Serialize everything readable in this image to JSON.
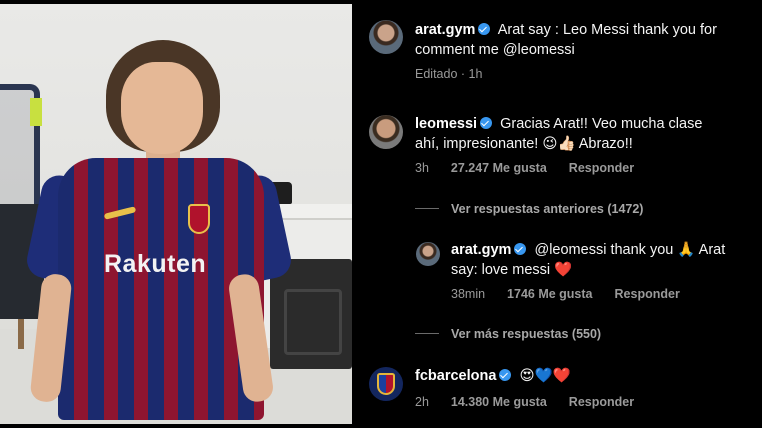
{
  "comments": [
    {
      "username": "arat.gym",
      "text": "Arat say : Leo Messi thank you for comment me @leomessi",
      "time": "Editado · 1h"
    },
    {
      "username": "leomessi",
      "text_line1": "Gracias Arat!! Veo mucha clase",
      "text_line2": "ahí, impresionante! ",
      "emojis": "😉👍🏻",
      "text_end": " Abrazo!!",
      "time": "3h",
      "likes": "27.247 Me gusta",
      "reply": "Responder",
      "view_previous": "Ver respuestas anteriores (1472)",
      "reply_thread": {
        "username": "arat.gym",
        "text_line1": "@leomessi thank you",
        "pray_emoji": "🙏",
        "text_line1_end": " Arat",
        "text_line2": "say: love messi",
        "heart_emoji": "❤️",
        "time": "38min",
        "likes": "1746 Me gusta",
        "reply": "Responder"
      },
      "view_more": "Ver más respuestas (550)"
    },
    {
      "username": "fcbarcelona",
      "emojis_face": "😍",
      "emojis_blue": "💙",
      "emojis_red": "❤️",
      "time": "2h",
      "likes": "14.380 Me gusta",
      "reply": "Responder"
    }
  ],
  "photo": {
    "sponsor": "Rakuten"
  },
  "colors": {
    "verified": "#3897f0",
    "background": "#000000",
    "meta_text": "#9a9a9a"
  }
}
